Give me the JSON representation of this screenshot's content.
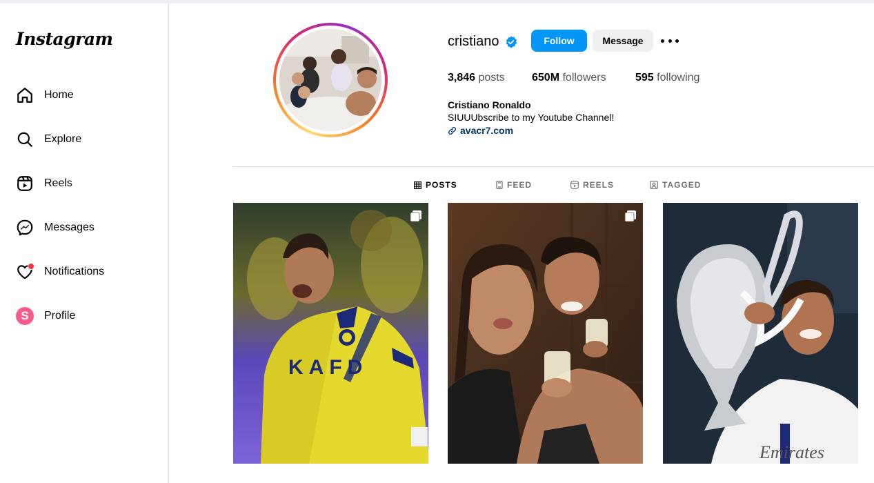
{
  "sidebar": {
    "logo": "Instagram",
    "items": [
      {
        "label": "Home",
        "icon": "home-icon"
      },
      {
        "label": "Explore",
        "icon": "search-icon"
      },
      {
        "label": "Reels",
        "icon": "reels-icon"
      },
      {
        "label": "Messages",
        "icon": "messenger-icon"
      },
      {
        "label": "Notifications",
        "icon": "heart-icon"
      },
      {
        "label": "Profile",
        "icon": "profile-avatar",
        "avatar_letter": "S"
      }
    ]
  },
  "profile": {
    "username": "cristiano",
    "verified": true,
    "follow_label": "Follow",
    "message_label": "Message",
    "stats": {
      "posts_count": "3,846",
      "posts_label": "posts",
      "followers_count": "650M",
      "followers_label": "followers",
      "following_count": "595",
      "following_label": "following"
    },
    "full_name": "Cristiano Ronaldo",
    "bio": "SIUUUbscribe to my Youtube Channel!",
    "link": "avacr7.com"
  },
  "tabs": [
    {
      "label": "POSTS",
      "active": true,
      "icon": "grid-icon"
    },
    {
      "label": "FEED",
      "active": false,
      "icon": "feed-icon"
    },
    {
      "label": "REELS",
      "active": false,
      "icon": "reels-icon"
    },
    {
      "label": "TAGGED",
      "active": false,
      "icon": "tagged-icon"
    }
  ],
  "posts": [
    {
      "description": "player-celebrating-yellow-kit",
      "multi": true,
      "shirt_text": "KAFD"
    },
    {
      "description": "couple-selfie-holding-glasses",
      "multi": true
    },
    {
      "description": "player-lifting-trophy",
      "multi": false,
      "shirt_text": "Emirates"
    }
  ],
  "colors": {
    "accent": "#0095f6",
    "link": "#00376b",
    "notification_dot": "#ff3040",
    "profile_avatar": "#f75b8e"
  }
}
